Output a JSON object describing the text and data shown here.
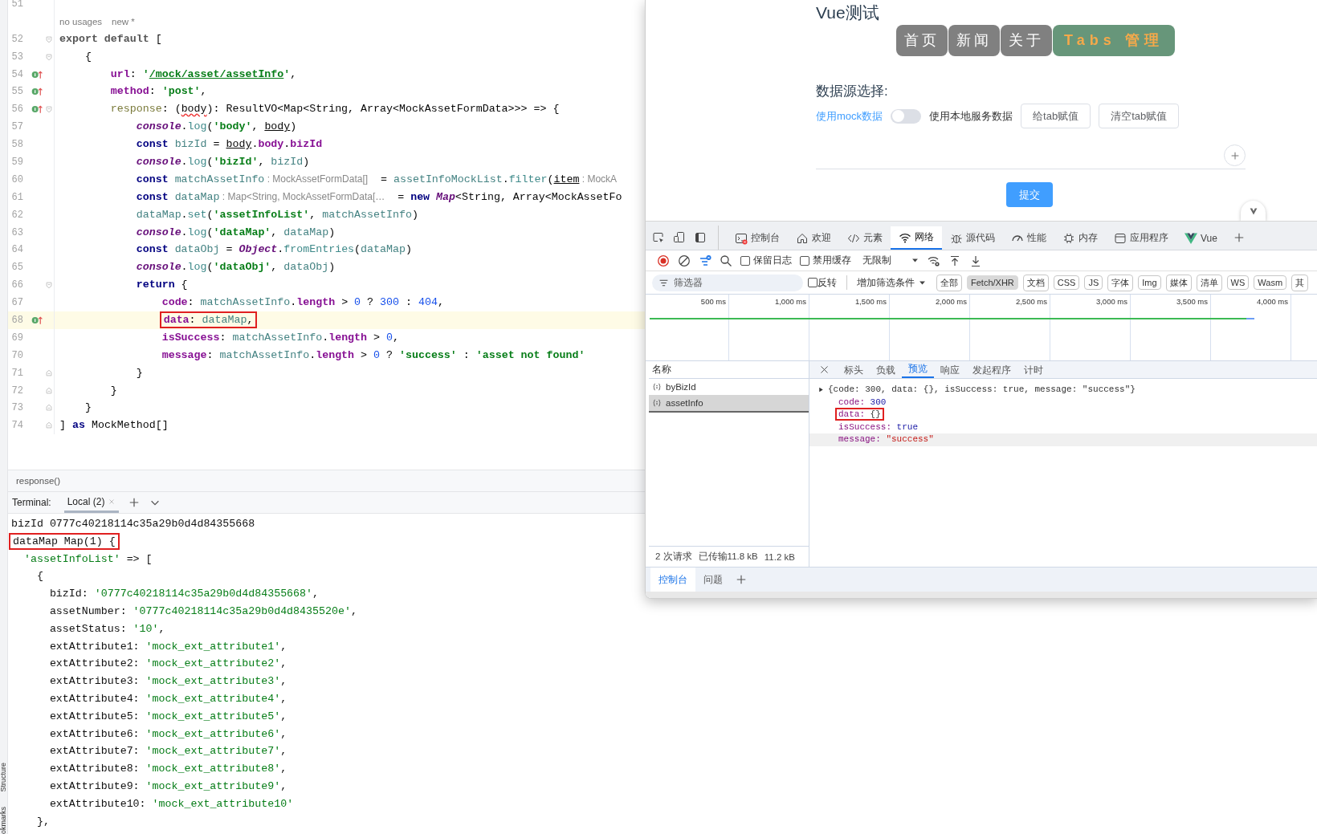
{
  "tool_stripe": [
    "Structure",
    "okmarks"
  ],
  "editor": {
    "lines": [
      {
        "kind": "code",
        "number": "51",
        "marker": false,
        "fold_start": false,
        "fold_end": false,
        "current": false
      },
      {
        "kind": "inlay",
        "hints": [
          "no usages",
          "new *"
        ]
      },
      {
        "kind": "code",
        "number": "52",
        "marker": false,
        "fold_start": true,
        "fold_end": false,
        "current": false,
        "segments": [
          {
            "text": "export default",
            "kind": "kwdim"
          },
          {
            "text": " [",
            "kind": "plain"
          }
        ]
      },
      {
        "kind": "code",
        "number": "53",
        "marker": false,
        "fold_start": true,
        "fold_end": false,
        "current": false,
        "segments": [
          {
            "text": "    {",
            "kind": "plain"
          }
        ]
      },
      {
        "kind": "code",
        "number": "54",
        "marker": true,
        "fold_start": false,
        "fold_end": false,
        "current": false,
        "segments": [
          {
            "text": "        url",
            "kind": "prop"
          },
          {
            "text": ": ",
            "kind": "plain"
          },
          {
            "text": "'",
            "kind": "str"
          },
          {
            "text": "/mock/asset/assetInfo",
            "kind": "link"
          },
          {
            "text": "'",
            "kind": "str"
          },
          {
            "text": ",",
            "kind": "plain"
          }
        ]
      },
      {
        "kind": "code",
        "number": "55",
        "marker": true,
        "fold_start": false,
        "fold_end": false,
        "current": false,
        "segments": [
          {
            "text": "        method",
            "kind": "prop"
          },
          {
            "text": ": ",
            "kind": "plain"
          },
          {
            "text": "'post'",
            "kind": "str"
          },
          {
            "text": ",",
            "kind": "plain"
          }
        ]
      },
      {
        "kind": "code",
        "number": "56",
        "marker": true,
        "fold_start": true,
        "fold_end": false,
        "current": false,
        "segments": [
          {
            "text": "        response",
            "kind": "method"
          },
          {
            "text": ": (",
            "kind": "plain"
          },
          {
            "text": "body",
            "kind": "param_warn"
          },
          {
            "text": "): ResultVO<Map<String, Array<MockAssetFormData>>> => {",
            "kind": "plain"
          }
        ]
      },
      {
        "kind": "code",
        "number": "57",
        "marker": false,
        "fold_start": false,
        "fold_end": false,
        "current": false,
        "segments": [
          {
            "text": "            console",
            "kind": "global"
          },
          {
            "text": ".",
            "kind": "plain"
          },
          {
            "text": "log",
            "kind": "fn"
          },
          {
            "text": "(",
            "kind": "plain"
          },
          {
            "text": "'body'",
            "kind": "str"
          },
          {
            "text": ", ",
            "kind": "plain"
          },
          {
            "text": "body",
            "kind": "param"
          },
          {
            "text": ")",
            "kind": "plain"
          }
        ]
      },
      {
        "kind": "code",
        "number": "58",
        "marker": false,
        "fold_start": false,
        "fold_end": false,
        "current": false,
        "segments": [
          {
            "text": "            const",
            "kind": "kw"
          },
          {
            "text": " bizId",
            "kind": "var"
          },
          {
            "text": " = ",
            "kind": "plain"
          },
          {
            "text": "body",
            "kind": "param"
          },
          {
            "text": ".",
            "kind": "plain"
          },
          {
            "text": "body",
            "kind": "prop"
          },
          {
            "text": ".",
            "kind": "plain"
          },
          {
            "text": "bizId",
            "kind": "prop"
          }
        ]
      },
      {
        "kind": "code",
        "number": "59",
        "marker": false,
        "fold_start": false,
        "fold_end": false,
        "current": false,
        "segments": [
          {
            "text": "            console",
            "kind": "global"
          },
          {
            "text": ".",
            "kind": "plain"
          },
          {
            "text": "log",
            "kind": "fn"
          },
          {
            "text": "(",
            "kind": "plain"
          },
          {
            "text": "'bizId'",
            "kind": "str"
          },
          {
            "text": ", ",
            "kind": "plain"
          },
          {
            "text": "bizId",
            "kind": "var"
          },
          {
            "text": ")",
            "kind": "plain"
          }
        ]
      },
      {
        "kind": "code",
        "number": "60",
        "marker": false,
        "fold_start": false,
        "fold_end": false,
        "current": false,
        "segments": [
          {
            "text": "            const",
            "kind": "kw"
          },
          {
            "text": " matchAssetInfo",
            "kind": "var"
          },
          {
            "text": " : MockAssetFormData[]",
            "kind": "hint"
          },
          {
            "text": "  = ",
            "kind": "plain"
          },
          {
            "text": "assetInfoMockList",
            "kind": "var"
          },
          {
            "text": ".",
            "kind": "plain"
          },
          {
            "text": "filter",
            "kind": "fn"
          },
          {
            "text": "(",
            "kind": "plain"
          },
          {
            "text": "item",
            "kind": "param"
          },
          {
            "text": " : MockA",
            "kind": "hint"
          }
        ]
      },
      {
        "kind": "code",
        "number": "61",
        "marker": false,
        "fold_start": false,
        "fold_end": false,
        "current": false,
        "segments": [
          {
            "text": "            const",
            "kind": "kw"
          },
          {
            "text": " dataMap",
            "kind": "var"
          },
          {
            "text": " : Map<String, MockAssetFormData[…",
            "kind": "hint"
          },
          {
            "text": "  = ",
            "kind": "plain"
          },
          {
            "text": "new",
            "kind": "kw"
          },
          {
            "text": " Map",
            "kind": "global"
          },
          {
            "text": "<String, Array<MockAssetFo",
            "kind": "plain"
          }
        ]
      },
      {
        "kind": "code",
        "number": "62",
        "marker": false,
        "fold_start": false,
        "fold_end": false,
        "current": false,
        "segments": [
          {
            "text": "            dataMap",
            "kind": "var"
          },
          {
            "text": ".",
            "kind": "plain"
          },
          {
            "text": "set",
            "kind": "fn"
          },
          {
            "text": "(",
            "kind": "plain"
          },
          {
            "text": "'assetInfoList'",
            "kind": "str"
          },
          {
            "text": ", ",
            "kind": "plain"
          },
          {
            "text": "matchAssetInfo",
            "kind": "var"
          },
          {
            "text": ")",
            "kind": "plain"
          }
        ]
      },
      {
        "kind": "code",
        "number": "63",
        "marker": false,
        "fold_start": false,
        "fold_end": false,
        "current": false,
        "segments": [
          {
            "text": "            console",
            "kind": "global"
          },
          {
            "text": ".",
            "kind": "plain"
          },
          {
            "text": "log",
            "kind": "fn"
          },
          {
            "text": "(",
            "kind": "plain"
          },
          {
            "text": "'dataMap'",
            "kind": "str"
          },
          {
            "text": ", ",
            "kind": "plain"
          },
          {
            "text": "dataMap",
            "kind": "var"
          },
          {
            "text": ")",
            "kind": "plain"
          }
        ]
      },
      {
        "kind": "code",
        "number": "64",
        "marker": false,
        "fold_start": false,
        "fold_end": false,
        "current": false,
        "segments": [
          {
            "text": "            const",
            "kind": "kw"
          },
          {
            "text": " dataObj",
            "kind": "var"
          },
          {
            "text": " = ",
            "kind": "plain"
          },
          {
            "text": "Object",
            "kind": "global"
          },
          {
            "text": ".",
            "kind": "plain"
          },
          {
            "text": "fromEntries",
            "kind": "fn"
          },
          {
            "text": "(",
            "kind": "plain"
          },
          {
            "text": "dataMap",
            "kind": "var"
          },
          {
            "text": ")",
            "kind": "plain"
          }
        ]
      },
      {
        "kind": "code",
        "number": "65",
        "marker": false,
        "fold_start": false,
        "fold_end": false,
        "current": false,
        "segments": [
          {
            "text": "            console",
            "kind": "global"
          },
          {
            "text": ".",
            "kind": "plain"
          },
          {
            "text": "log",
            "kind": "fn"
          },
          {
            "text": "(",
            "kind": "plain"
          },
          {
            "text": "'dataObj'",
            "kind": "str"
          },
          {
            "text": ", ",
            "kind": "plain"
          },
          {
            "text": "dataObj",
            "kind": "var"
          },
          {
            "text": ")",
            "kind": "plain"
          }
        ]
      },
      {
        "kind": "code",
        "number": "66",
        "marker": false,
        "fold_start": true,
        "fold_end": false,
        "current": false,
        "segments": [
          {
            "text": "            return",
            "kind": "kw"
          },
          {
            "text": " {",
            "kind": "plain"
          }
        ]
      },
      {
        "kind": "code",
        "number": "67",
        "marker": false,
        "fold_start": false,
        "fold_end": false,
        "current": false,
        "segments": [
          {
            "text": "                code",
            "kind": "prop"
          },
          {
            "text": ": ",
            "kind": "plain"
          },
          {
            "text": "matchAssetInfo",
            "kind": "var"
          },
          {
            "text": ".",
            "kind": "plain"
          },
          {
            "text": "length",
            "kind": "prop"
          },
          {
            "text": " > ",
            "kind": "plain"
          },
          {
            "text": "0",
            "kind": "num"
          },
          {
            "text": " ? ",
            "kind": "plain"
          },
          {
            "text": "300",
            "kind": "num"
          },
          {
            "text": " : ",
            "kind": "plain"
          },
          {
            "text": "404",
            "kind": "num"
          },
          {
            "text": ",",
            "kind": "plain"
          }
        ]
      },
      {
        "kind": "code",
        "number": "68",
        "marker": true,
        "fold_start": false,
        "fold_end": false,
        "current": true,
        "segments": [
          {
            "kind": "box",
            "segments": [
              {
                "text": "data",
                "kind": "prop"
              },
              {
                "text": ": ",
                "kind": "plain"
              },
              {
                "text": "dataMap",
                "kind": "var"
              },
              {
                "text": ",",
                "kind": "plain"
              }
            ]
          }
        ]
      },
      {
        "kind": "code",
        "number": "69",
        "marker": false,
        "fold_start": false,
        "fold_end": false,
        "current": false,
        "segments": [
          {
            "text": "                isSuccess",
            "kind": "prop"
          },
          {
            "text": ": ",
            "kind": "plain"
          },
          {
            "text": "matchAssetInfo",
            "kind": "var"
          },
          {
            "text": ".",
            "kind": "plain"
          },
          {
            "text": "length",
            "kind": "prop"
          },
          {
            "text": " > ",
            "kind": "plain"
          },
          {
            "text": "0",
            "kind": "num"
          },
          {
            "text": ",",
            "kind": "plain"
          }
        ]
      },
      {
        "kind": "code",
        "number": "70",
        "marker": false,
        "fold_start": false,
        "fold_end": false,
        "current": false,
        "segments": [
          {
            "text": "                message",
            "kind": "prop"
          },
          {
            "text": ": ",
            "kind": "plain"
          },
          {
            "text": "matchAssetInfo",
            "kind": "var"
          },
          {
            "text": ".",
            "kind": "plain"
          },
          {
            "text": "length",
            "kind": "prop"
          },
          {
            "text": " > ",
            "kind": "plain"
          },
          {
            "text": "0",
            "kind": "num"
          },
          {
            "text": " ? ",
            "kind": "plain"
          },
          {
            "text": "'success'",
            "kind": "str"
          },
          {
            "text": " : ",
            "kind": "plain"
          },
          {
            "text": "'asset not found'",
            "kind": "str"
          }
        ]
      },
      {
        "kind": "code",
        "number": "71",
        "marker": false,
        "fold_start": false,
        "fold_end": true,
        "current": false,
        "segments": [
          {
            "text": "            }",
            "kind": "plain"
          }
        ]
      },
      {
        "kind": "code",
        "number": "72",
        "marker": false,
        "fold_start": false,
        "fold_end": true,
        "current": false,
        "segments": [
          {
            "text": "        }",
            "kind": "plain"
          }
        ]
      },
      {
        "kind": "code",
        "number": "73",
        "marker": false,
        "fold_start": false,
        "fold_end": true,
        "current": false,
        "segments": [
          {
            "text": "    }",
            "kind": "plain"
          }
        ]
      },
      {
        "kind": "code",
        "number": "74",
        "marker": false,
        "fold_start": false,
        "fold_end": true,
        "current": false,
        "segments": [
          {
            "text": "] ",
            "kind": "plain"
          },
          {
            "text": "as",
            "kind": "kw"
          },
          {
            "text": " MockMethod[]",
            "kind": "plain"
          }
        ]
      }
    ]
  },
  "breadcrumb": "response()",
  "terminal": {
    "label": "Terminal:",
    "tabs": [
      {
        "label": "Local (2)",
        "selected": true
      }
    ],
    "lines": [
      [
        {
          "text": "bizId 0777c40218114c35a29b0d4d84355668",
          "kind": "plain"
        }
      ],
      [
        {
          "kind": "box",
          "segments": [
            {
              "text": "dataMap Map(1) {",
              "kind": "plain"
            }
          ]
        }
      ],
      [
        {
          "text": "  'assetInfoList'",
          "kind": "tstr"
        },
        {
          "text": " => [",
          "kind": "plain"
        }
      ],
      [
        {
          "text": "    {",
          "kind": "plain"
        }
      ],
      [
        {
          "text": "      bizId: ",
          "kind": "plain"
        },
        {
          "text": "'0777c40218114c35a29b0d4d84355668'",
          "kind": "tstr"
        },
        {
          "text": ",",
          "kind": "plain"
        }
      ],
      [
        {
          "text": "      assetNumber: ",
          "kind": "plain"
        },
        {
          "text": "'0777c40218114c35a29b0d4d8435520e'",
          "kind": "tstr"
        },
        {
          "text": ",",
          "kind": "plain"
        }
      ],
      [
        {
          "text": "      assetStatus: ",
          "kind": "plain"
        },
        {
          "text": "'10'",
          "kind": "tstr"
        },
        {
          "text": ",",
          "kind": "plain"
        }
      ],
      [
        {
          "text": "      extAttribute1: ",
          "kind": "plain"
        },
        {
          "text": "'mock_ext_attribute1'",
          "kind": "tstr"
        },
        {
          "text": ",",
          "kind": "plain"
        }
      ],
      [
        {
          "text": "      extAttribute2: ",
          "kind": "plain"
        },
        {
          "text": "'mock_ext_attribute2'",
          "kind": "tstr"
        },
        {
          "text": ",",
          "kind": "plain"
        }
      ],
      [
        {
          "text": "      extAttribute3: ",
          "kind": "plain"
        },
        {
          "text": "'mock_ext_attribute3'",
          "kind": "tstr"
        },
        {
          "text": ",",
          "kind": "plain"
        }
      ],
      [
        {
          "text": "      extAttribute4: ",
          "kind": "plain"
        },
        {
          "text": "'mock_ext_attribute4'",
          "kind": "tstr"
        },
        {
          "text": ",",
          "kind": "plain"
        }
      ],
      [
        {
          "text": "      extAttribute5: ",
          "kind": "plain"
        },
        {
          "text": "'mock_ext_attribute5'",
          "kind": "tstr"
        },
        {
          "text": ",",
          "kind": "plain"
        }
      ],
      [
        {
          "text": "      extAttribute6: ",
          "kind": "plain"
        },
        {
          "text": "'mock_ext_attribute6'",
          "kind": "tstr"
        },
        {
          "text": ",",
          "kind": "plain"
        }
      ],
      [
        {
          "text": "      extAttribute7: ",
          "kind": "plain"
        },
        {
          "text": "'mock_ext_attribute7'",
          "kind": "tstr"
        },
        {
          "text": ",",
          "kind": "plain"
        }
      ],
      [
        {
          "text": "      extAttribute8: ",
          "kind": "plain"
        },
        {
          "text": "'mock_ext_attribute8'",
          "kind": "tstr"
        },
        {
          "text": ",",
          "kind": "plain"
        }
      ],
      [
        {
          "text": "      extAttribute9: ",
          "kind": "plain"
        },
        {
          "text": "'mock_ext_attribute9'",
          "kind": "tstr"
        },
        {
          "text": ",",
          "kind": "plain"
        }
      ],
      [
        {
          "text": "      extAttribute10: ",
          "kind": "plain"
        },
        {
          "text": "'mock_ext_attribute10'",
          "kind": "tstr"
        }
      ],
      [
        {
          "text": "    },",
          "kind": "plain"
        }
      ]
    ]
  },
  "browser": {
    "page": {
      "title": "Vue测试",
      "nav": [
        {
          "label": "首页",
          "selected": false
        },
        {
          "label": "新闻",
          "selected": false
        },
        {
          "label": "关于",
          "selected": false
        },
        {
          "label": "Tabs 管理",
          "selected": true
        }
      ],
      "source_label": "数据源选择:",
      "mock_label": "使用mock数据",
      "toggle": {
        "on": false
      },
      "local_label": "使用本地服务数据",
      "buttons": [
        "给tab赋值",
        "清空tab赋值"
      ],
      "submit": "提交"
    },
    "devtools": {
      "tabs": [
        {
          "label": "控制台",
          "selected": false
        },
        {
          "label": "欢迎",
          "selected": false
        },
        {
          "label": "元素",
          "selected": false
        },
        {
          "label": "网络",
          "selected": true
        },
        {
          "label": "源代码",
          "selected": false
        },
        {
          "label": "性能",
          "selected": false
        },
        {
          "label": "内存",
          "selected": false
        },
        {
          "label": "应用程序",
          "selected": false
        },
        {
          "label": "Vue",
          "selected": false
        }
      ],
      "toolbar": {
        "checkboxes": [
          {
            "label": "保留日志",
            "checked": false
          },
          {
            "label": "禁用缓存",
            "checked": false
          }
        ],
        "throttle": "无限制"
      },
      "filter": {
        "placeholder": "筛选器",
        "invert": {
          "label": "反转",
          "checked": false
        },
        "more": "增加筛选条件",
        "types": [
          {
            "label": "全部",
            "selected": false
          },
          {
            "label": "Fetch/XHR",
            "selected": true
          },
          {
            "label": "文档",
            "selected": false
          },
          {
            "label": "CSS",
            "selected": false
          },
          {
            "label": "JS",
            "selected": false
          },
          {
            "label": "字体",
            "selected": false
          },
          {
            "label": "Img",
            "selected": false
          },
          {
            "label": "媒体",
            "selected": false
          },
          {
            "label": "清单",
            "selected": false
          },
          {
            "label": "WS",
            "selected": false
          },
          {
            "label": "Wasm",
            "selected": false
          },
          {
            "label": "其",
            "selected": false
          }
        ]
      },
      "timeline": {
        "ticks": [
          "500 ms",
          "1,000 ms",
          "1,500 ms",
          "2,000 ms",
          "2,500 ms",
          "3,000 ms",
          "3,500 ms",
          "4,000 ms"
        ]
      },
      "requests": {
        "header": "名称",
        "items": [
          {
            "name": "byBizId",
            "selected": false
          },
          {
            "name": "assetInfo",
            "selected": true
          }
        ],
        "summary": [
          "2 次请求",
          "已传输11.8 kB",
          "11.2 kB"
        ]
      },
      "detail": {
        "tabs": [
          {
            "label": "标头",
            "selected": false
          },
          {
            "label": "负载",
            "selected": false
          },
          {
            "label": "预览",
            "selected": true
          },
          {
            "label": "响应",
            "selected": false
          },
          {
            "label": "发起程序",
            "selected": false
          },
          {
            "label": "计时",
            "selected": false
          }
        ],
        "summary": "{code: 300, data: {}, isSuccess: true, message: \"success\"}",
        "fields": [
          {
            "key": "code:",
            "value": "300",
            "kind": "number",
            "boxed": false,
            "highlighted": false
          },
          {
            "key": "data:",
            "value": "{}",
            "kind": "object",
            "boxed": true,
            "highlighted": false
          },
          {
            "key": "isSuccess:",
            "value": "true",
            "kind": "bool",
            "boxed": false,
            "highlighted": false
          },
          {
            "key": "message:",
            "value": "\"success\"",
            "kind": "string",
            "boxed": false,
            "highlighted": true
          }
        ]
      },
      "drawer": [
        {
          "label": "控制台",
          "selected": true
        },
        {
          "label": "问题",
          "selected": false
        }
      ]
    }
  }
}
